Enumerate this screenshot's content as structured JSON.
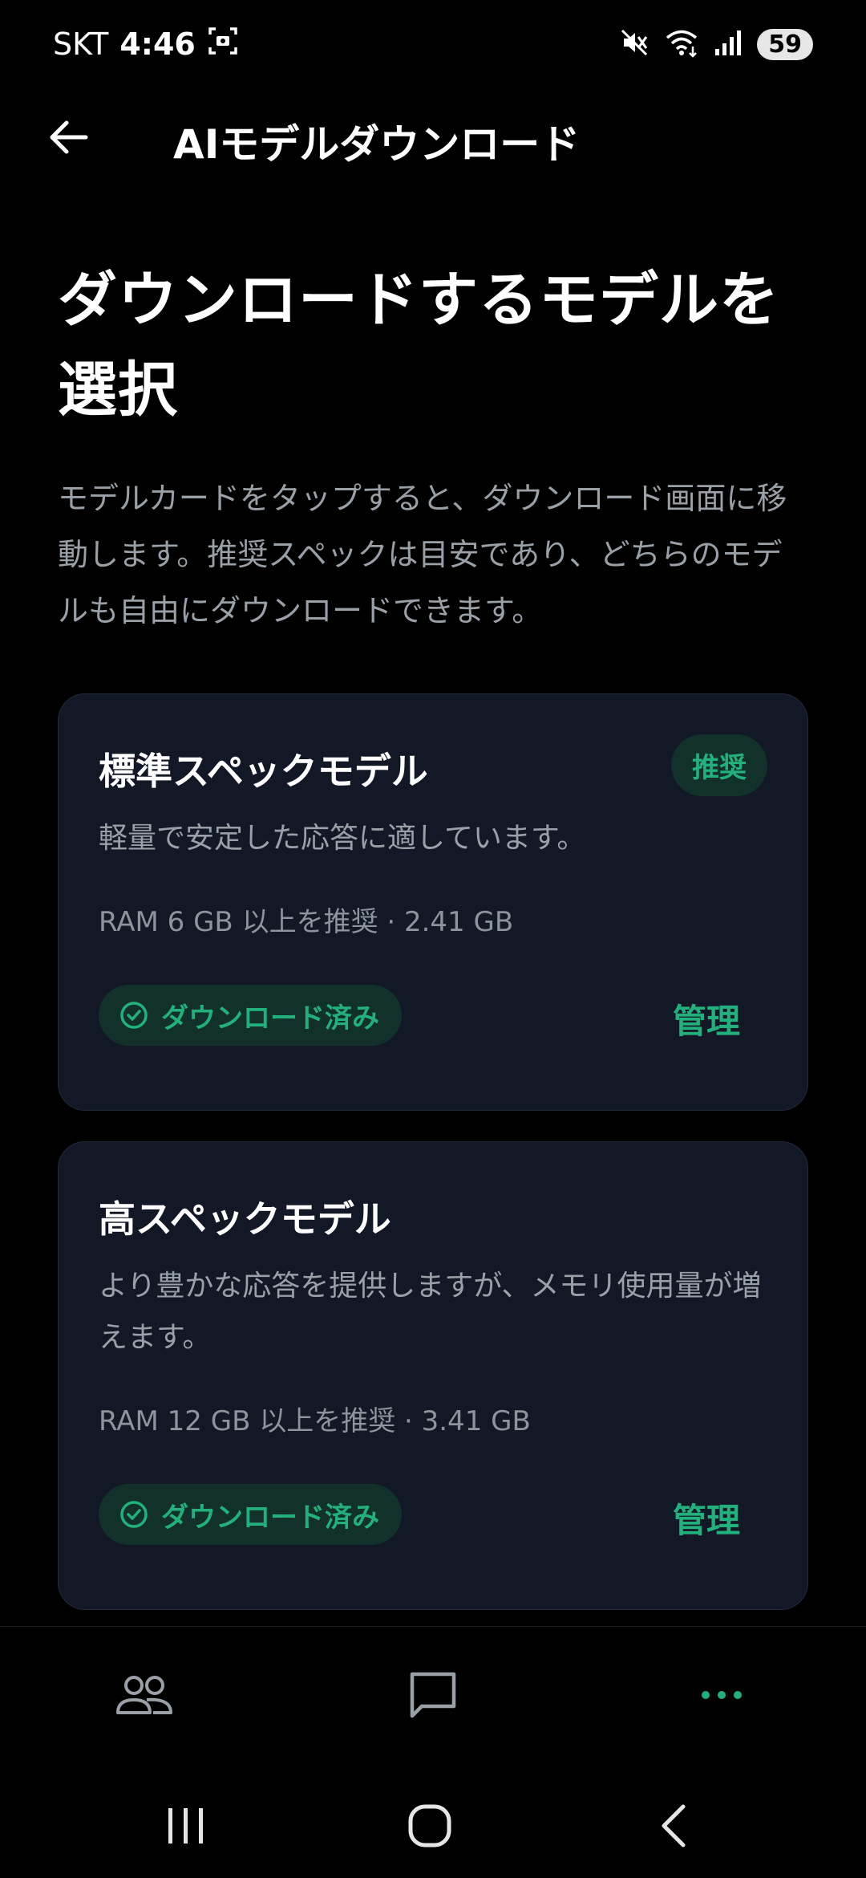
{
  "status_bar": {
    "carrier": "SKT",
    "time": "4:46",
    "battery": "59"
  },
  "app_bar": {
    "title": "AIモデルダウンロード"
  },
  "content": {
    "heading_line1": "ダウンロードするモデルを",
    "heading_line2": "選択",
    "description": "モデルカードをタップすると、ダウンロード画面に移動します。推奨スペックは目安であり、どちらのモデルも自由にダウンロードできます。"
  },
  "cards": [
    {
      "title": "標準スペックモデル",
      "badge": "推奨",
      "description": "軽量で安定した応答に適しています。",
      "spec": "RAM 6 GB 以上を推奨 · 2.41 GB",
      "status": "ダウンロード済み",
      "action": "管理"
    },
    {
      "title": "高スペックモデル",
      "description": "より豊かな応答を提供しますが、メモリ使用量が増えます。",
      "spec": "RAM 12 GB 以上を推奨 · 3.41 GB",
      "status": "ダウンロード済み",
      "action": "管理"
    }
  ],
  "colors": {
    "accent": "#22b07d",
    "card_bg": "#121826",
    "muted_text": "#9aa0a8"
  }
}
